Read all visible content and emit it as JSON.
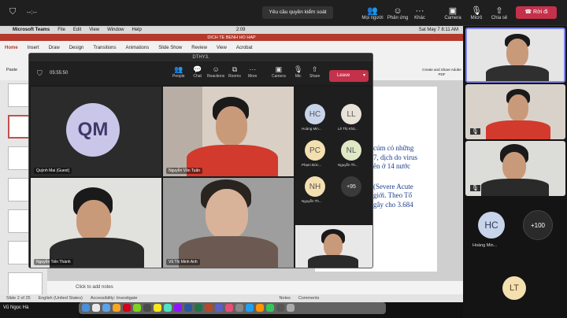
{
  "topbar": {
    "timer": "--:--",
    "control_request": "Yêu cầu quyền kiểm soát",
    "buttons": [
      {
        "label": "Mọi người",
        "icon": "people-icon"
      },
      {
        "label": "Phản ứng",
        "icon": "reaction-icon"
      },
      {
        "label": "Khác",
        "icon": "more-icon"
      },
      {
        "label": "Camera",
        "icon": "camera-icon"
      },
      {
        "label": "Micrô",
        "icon": "mic-icon"
      },
      {
        "label": "Chia sẻ",
        "icon": "share-icon"
      }
    ],
    "leave_label": "Rời đi"
  },
  "mac_menu": {
    "app": "Microsoft Teams",
    "items": [
      "File",
      "Edit",
      "View",
      "Window",
      "Help"
    ],
    "clock": "Sat May 7  8:11 AM",
    "time_small": "2:09"
  },
  "powerpoint": {
    "doc_title": "DICH TE BENH HO HAP",
    "tabs": [
      "Home",
      "Insert",
      "Draw",
      "Design",
      "Transitions",
      "Animations",
      "Slide Show",
      "Review",
      "View",
      "Acrobat"
    ],
    "paste_label": "Paste",
    "create_share": "Create and Share Adobe PDF",
    "slide_text": [
      "cúm có những",
      "7, dịch do virus",
      "ên ở 14 nước",
      "(Severe Acute",
      "giới. Theo Tổ",
      "gây cho 3.684"
    ],
    "notes_placeholder": "Click to add notes",
    "status": {
      "slide": "Slide 2 of 25",
      "language": "English (United States)",
      "accessibility": "Accessibility: Investigate",
      "notes": "Notes",
      "comments": "Comments"
    }
  },
  "meeting_window": {
    "title": "DTHY3.",
    "timer": "05:55:50",
    "controls": [
      {
        "label": "People",
        "icon": "people-icon"
      },
      {
        "label": "Chat",
        "icon": "chat-icon"
      },
      {
        "label": "Reactions",
        "icon": "reaction-icon"
      },
      {
        "label": "Rooms",
        "icon": "rooms-icon"
      },
      {
        "label": "More",
        "icon": "more-icon"
      },
      {
        "label": "Camera",
        "icon": "camera-icon"
      },
      {
        "label": "Mic",
        "icon": "mic-icon"
      },
      {
        "label": "Share",
        "icon": "share-icon"
      }
    ],
    "leave_label": "Leave",
    "tiles": [
      {
        "name": "Quỳnh Mai (Guest)",
        "initials": "QM"
      },
      {
        "name": "Nguyễn Văn Tuấn"
      },
      {
        "name": "Nguyễn Tiến Thành"
      },
      {
        "name": "Vũ Thị Minh Anh"
      }
    ],
    "side_avatars": [
      {
        "initials": "HC",
        "name": "Hoàng Min...",
        "color": "#c8d4ea"
      },
      {
        "initials": "LL",
        "name": "Lê Thị Khá...",
        "color": "#e9e2d8"
      },
      {
        "initials": "PC",
        "name": "Phạm Đức...",
        "color": "#f3dfb0"
      },
      {
        "initials": "NL",
        "name": "Nguyễn Th...",
        "color": "#dfe8c6"
      },
      {
        "initials": "NH",
        "name": "Nguyễn Th...",
        "color": "#f3dfb0"
      },
      {
        "initials": "+95",
        "name": "",
        "color": "#3a3a3a"
      }
    ]
  },
  "right_panel": {
    "avatars": [
      {
        "initials": "HC",
        "name": "Hoàng Min...",
        "color": "#c8d4ea"
      },
      {
        "initials": "+100",
        "name": "",
        "color": "#2a2a2a"
      },
      {
        "initials": "LT",
        "name": "",
        "color": "#f3dfb0"
      }
    ]
  },
  "bottom": {
    "user_name": "Vũ Ngọc Hà"
  },
  "colors": {
    "leave_red": "#c4314b",
    "ppt_red": "#b33a2c",
    "slide_text_blue": "#1a3c8c",
    "qm_avatar": "#c9c6ea"
  }
}
